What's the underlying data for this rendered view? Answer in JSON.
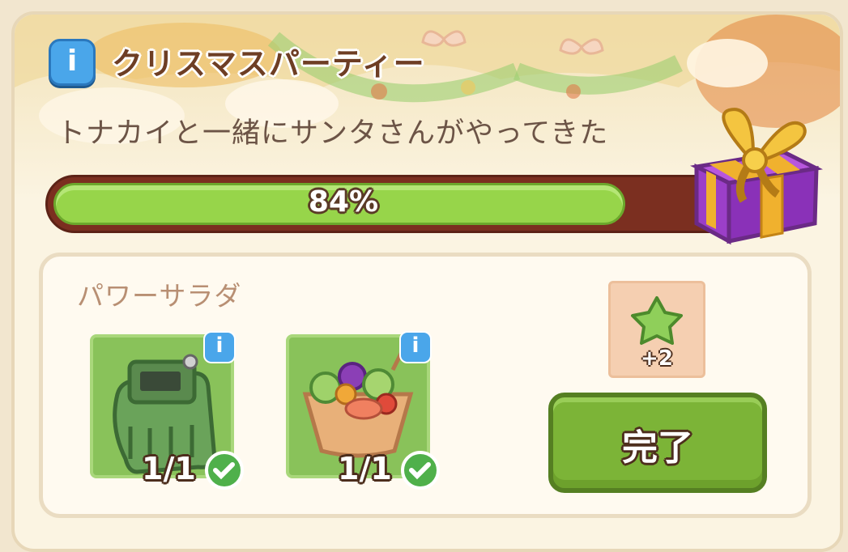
{
  "event": {
    "title": "クリスマスパーティー",
    "description": "トナカイと一緒にサンタさんがやってきた",
    "progress_value": 0.84,
    "progress_label": "84%"
  },
  "recipe": {
    "name": "パワーサラダ",
    "items": [
      {
        "icon": "glove-icon",
        "count": "1/1",
        "completed": true
      },
      {
        "icon": "salad-bowl-icon",
        "count": "1/1",
        "completed": true
      }
    ],
    "reward": {
      "icon": "green-star-icon",
      "amount": "+2"
    },
    "complete_label": "完了"
  },
  "colors": {
    "progress_fill": "#97d54a",
    "progress_track": "#7b2f20",
    "button": "#7cb437",
    "info": "#4aa6ea",
    "gift": "#9b3fc8"
  }
}
